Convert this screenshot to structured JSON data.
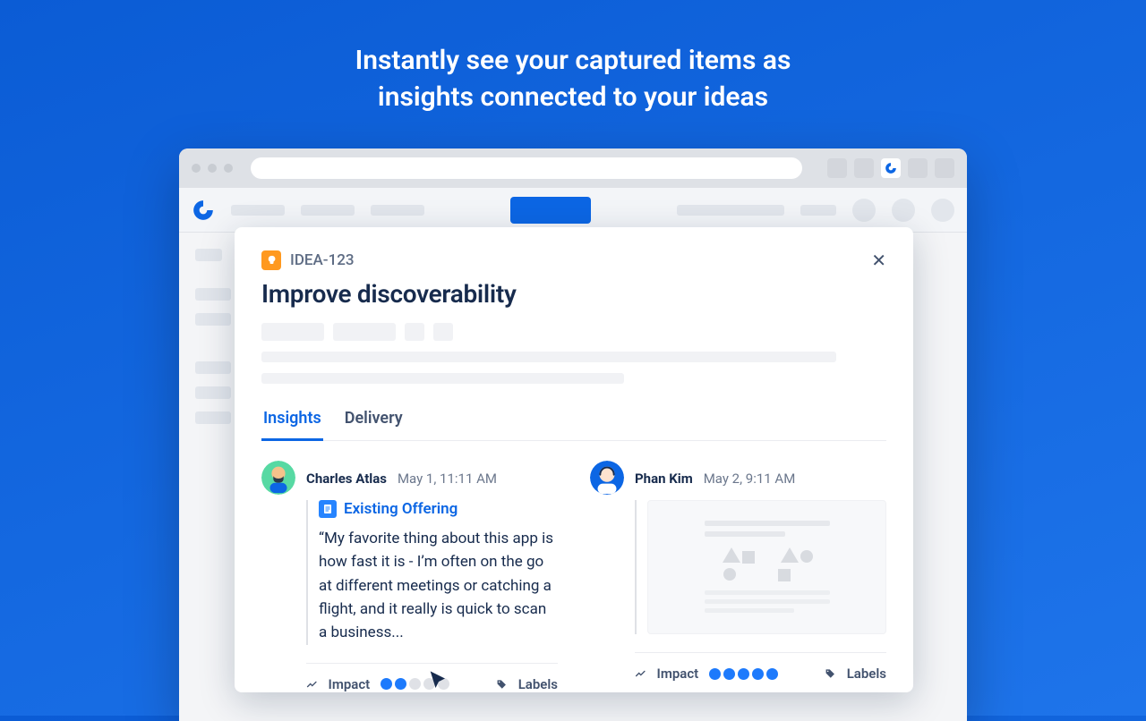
{
  "hero": {
    "line1": "Instantly see your captured items as",
    "line2": "insights connected to your ideas"
  },
  "idea": {
    "key": "IDEA-123",
    "title": "Improve discoverability"
  },
  "tabs": {
    "insights": "Insights",
    "delivery": "Delivery"
  },
  "insights": [
    {
      "author": "Charles Atlas",
      "timestamp": "May 1, 11:11 AM",
      "doc_title": "Existing Offering",
      "quote": "“My favorite thing about this app is how fast it is - I’m often on the go at different meetings or catching a flight, and it really is quick to scan a business...",
      "impact_label": "Impact",
      "impact_score": 2,
      "impact_max": 5,
      "labels_label": "Labels"
    },
    {
      "author": "Phan Kim",
      "timestamp": "May 2, 9:11 AM",
      "impact_label": "Impact",
      "impact_score": 5,
      "impact_max": 5,
      "labels_label": "Labels"
    }
  ]
}
